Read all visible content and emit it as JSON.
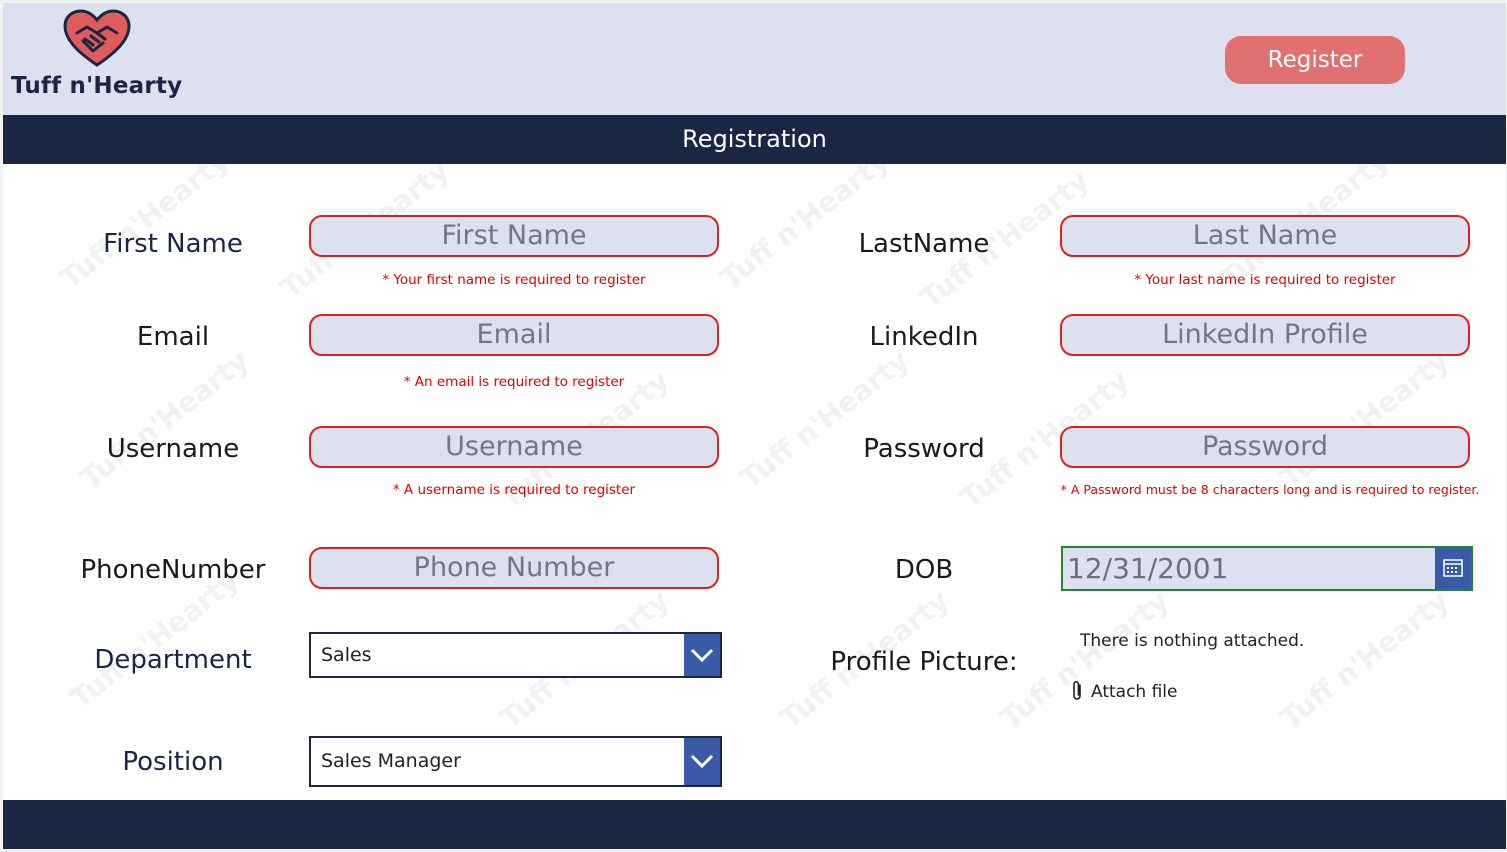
{
  "header": {
    "logo_text": "Tuff n'Hearty",
    "register_button": "Register"
  },
  "title": "Registration",
  "form": {
    "first_name": {
      "label": "First Name",
      "placeholder": "First Name",
      "error": "* Your first name is required to register"
    },
    "last_name": {
      "label": "LastName",
      "placeholder": "Last Name",
      "error": "* Your last name is required to register"
    },
    "email": {
      "label": "Email",
      "placeholder": "Email",
      "error": "* An email is required to register"
    },
    "linkedin": {
      "label": "LinkedIn",
      "placeholder": "LinkedIn Profile"
    },
    "username": {
      "label": "Username",
      "placeholder": "Username",
      "error": "* A username is required to register"
    },
    "password": {
      "label": "Password",
      "placeholder": "Password",
      "error": "* A Password must be 8 characters long and is required to register."
    },
    "phone": {
      "label": "PhoneNumber",
      "placeholder": "Phone Number"
    },
    "dob": {
      "label": "DOB",
      "value": "12/31/2001"
    },
    "department": {
      "label": "Department",
      "value": "Sales"
    },
    "position": {
      "label": "Position",
      "value": "Sales Manager"
    },
    "profile_picture": {
      "label": "Profile Picture:",
      "empty_text": "There is nothing attached.",
      "attach_label": "Attach file"
    }
  },
  "colors": {
    "header_bg": "#dde1ef",
    "navy": "#1b2645",
    "accent_red": "#e17070",
    "error_red": "#e00000",
    "dropdown_blue": "#3a5aa8",
    "date_border": "#1f8b2e"
  },
  "icons": [
    "heart-handshake-logo-icon",
    "calendar-icon",
    "chevron-down-icon",
    "paperclip-icon"
  ]
}
